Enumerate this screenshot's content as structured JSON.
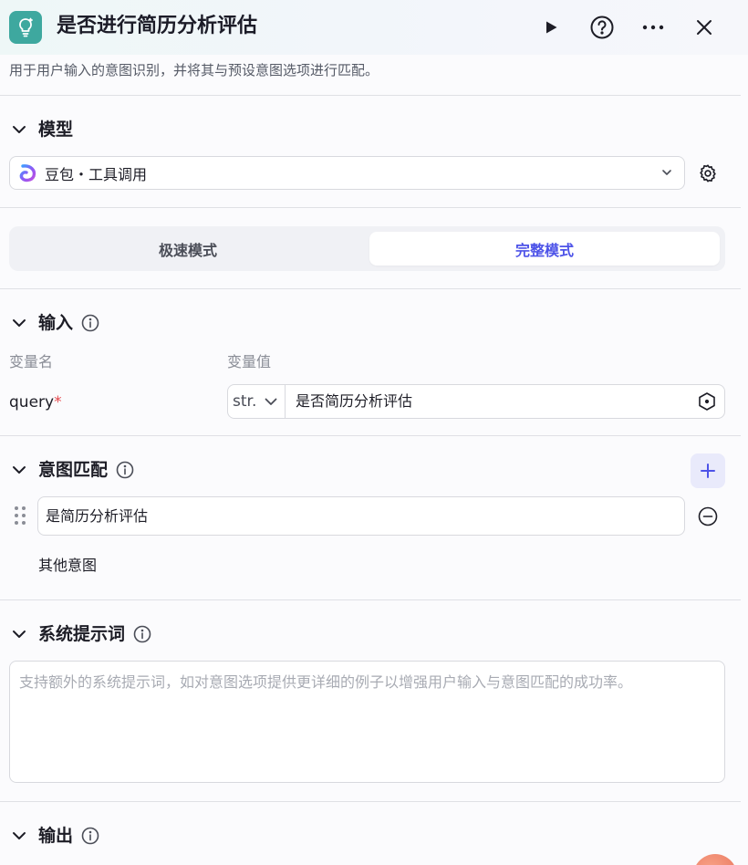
{
  "header": {
    "title": "是否进行简历分析评估",
    "description": "用于用户输入的意图识别，并将其与预设意图选项进行匹配。",
    "icons": [
      "intent-bulb-icon",
      "run-icon",
      "help-icon",
      "more-icon",
      "close-icon"
    ],
    "logo_color": "#3ea89f"
  },
  "model": {
    "section_title": "模型",
    "selected": "豆包・工具调用",
    "icons": [
      "doubao-logo-icon",
      "chevron-down-icon",
      "gear-icon"
    ]
  },
  "modes": {
    "fast_label": "极速模式",
    "full_label": "完整模式",
    "active": "full",
    "active_color": "#4d53e8"
  },
  "input": {
    "section_title": "输入",
    "col_name": "变量名",
    "col_value": "变量值",
    "var_name": "query",
    "required_mark": "*",
    "var_type": "str.",
    "var_value": "是否简历分析评估"
  },
  "intent": {
    "section_title": "意图匹配",
    "options": [
      {
        "value": "是简历分析评估"
      }
    ],
    "other_label": "其他意图"
  },
  "system_prompt": {
    "section_title": "系统提示词",
    "placeholder": "支持额外的系统提示词，如对意图选项提供更详细的例子以增强用户输入与意图匹配的成功率。"
  },
  "output": {
    "section_title": "输出"
  }
}
